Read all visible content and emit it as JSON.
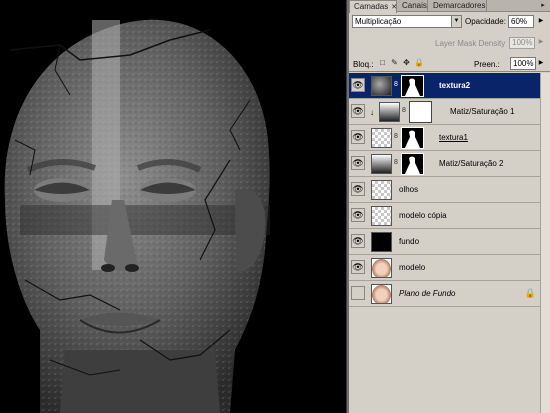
{
  "panel": {
    "tabs": [
      {
        "label": "Camadas",
        "closable": true,
        "active": true
      },
      {
        "label": "Canais",
        "closable": false,
        "active": false
      },
      {
        "label": "Demarcadores",
        "closable": false,
        "active": false
      }
    ],
    "menu_icon": "panel-menu-arrow-icon"
  },
  "options": {
    "blend_mode": "Multiplicação",
    "opacity_label": "Opacidade:",
    "opacity_value": "60%",
    "layer_mask_density_label": "Layer Mask Density",
    "layer_mask_density_value": "100%",
    "lock_label": "Bloq.:",
    "fill_label": "Preen.:",
    "fill_value": "100%"
  },
  "layers": [
    {
      "name": "textura2",
      "selected": true,
      "style": "bold",
      "thumb": "texture",
      "mask": "black",
      "clipped": false,
      "visible": true
    },
    {
      "name": "Matiz/Saturação 1",
      "selected": false,
      "style": "normal",
      "thumb": "gradient",
      "mask": "white",
      "clipped": true,
      "visible": true
    },
    {
      "name": "textura1",
      "selected": false,
      "style": "underline",
      "thumb": "checker",
      "mask": "black",
      "clipped": false,
      "visible": true
    },
    {
      "name": "Matiz/Saturação 2",
      "selected": false,
      "style": "normal",
      "thumb": "gradient",
      "mask": "black",
      "clipped": false,
      "visible": true
    },
    {
      "name": "olhos",
      "selected": false,
      "style": "normal",
      "thumb": "checker",
      "mask": null,
      "clipped": false,
      "visible": true
    },
    {
      "name": "modelo cópia",
      "selected": false,
      "style": "normal",
      "thumb": "checker",
      "mask": null,
      "clipped": false,
      "visible": true
    },
    {
      "name": "fundo",
      "selected": false,
      "style": "normal",
      "thumb": "black",
      "mask": null,
      "clipped": false,
      "visible": true
    },
    {
      "name": "modelo",
      "selected": false,
      "style": "normal",
      "thumb": "face",
      "mask": null,
      "clipped": false,
      "visible": true
    },
    {
      "name": "Plano de Fundo",
      "selected": false,
      "style": "italic",
      "thumb": "face",
      "mask": null,
      "clipped": false,
      "visible": false,
      "locked": true
    }
  ],
  "colors": {
    "selected_row": "#0a246a",
    "panel_bg": "#d4d0c8",
    "canvas_bg": "#000000"
  }
}
